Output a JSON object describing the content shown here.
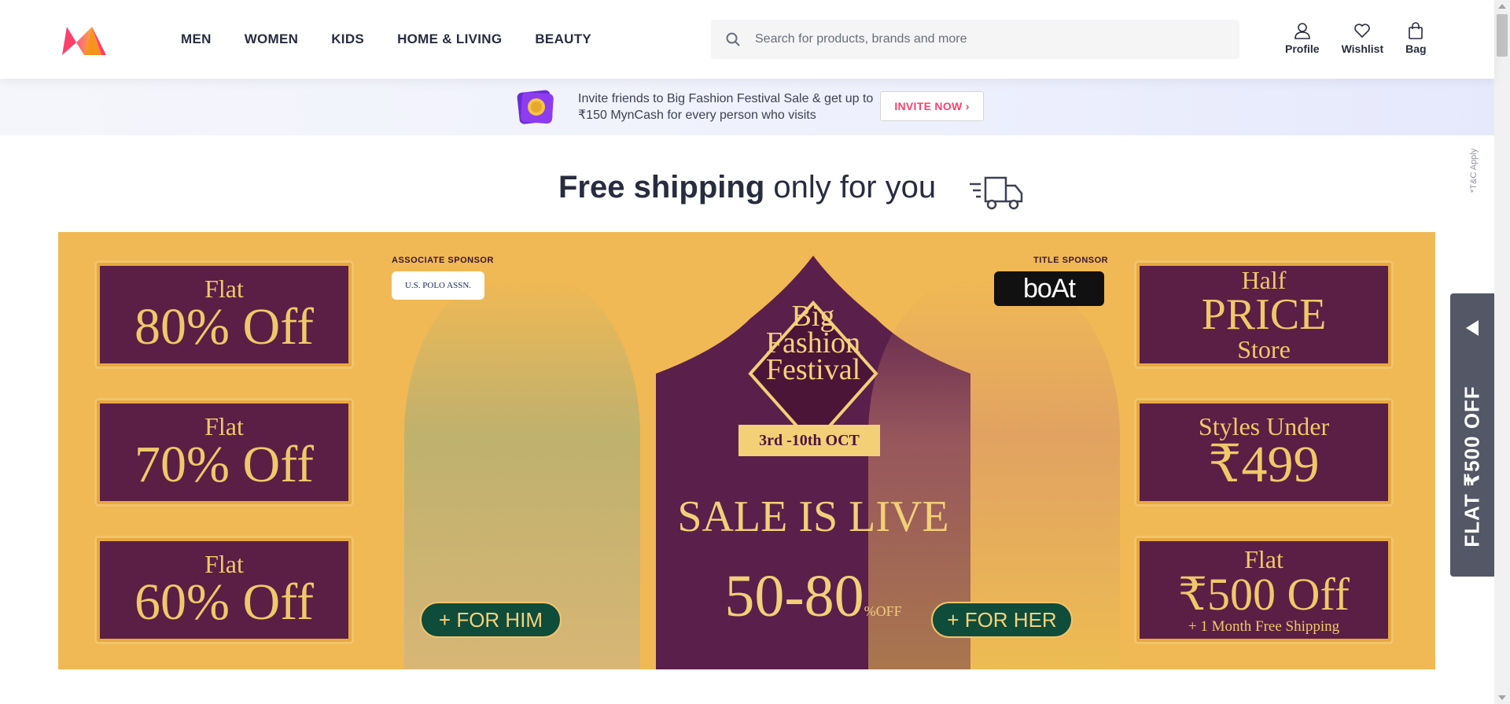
{
  "header": {
    "nav": [
      "MEN",
      "WOMEN",
      "KIDS",
      "HOME & LIVING",
      "BEAUTY"
    ],
    "search_placeholder": "Search for products, brands and more",
    "actions": {
      "profile": "Profile",
      "wishlist": "Wishlist",
      "bag": "Bag"
    }
  },
  "invite": {
    "text": "Invite friends to Big Fashion Festival Sale & get up to ₹150 MynCash for every person who visits",
    "button": "INVITE NOW ›"
  },
  "free_shipping": {
    "bold": "Free shipping",
    "rest": " only for you"
  },
  "banner": {
    "left_tiles": [
      {
        "line1": "Flat",
        "line2": "80% Off"
      },
      {
        "line1": "Flat",
        "line2": "70% Off"
      },
      {
        "line1": "Flat",
        "line2": "60% Off"
      }
    ],
    "right_tiles": {
      "half_price": {
        "line1": "Half",
        "line2": "PRICE",
        "line3": "Store"
      },
      "styles_under": {
        "line1": "Styles Under",
        "line2": "₹499"
      },
      "flat_500": {
        "line1": "Flat",
        "line2": "₹500 Off",
        "line3": "+ 1 Month Free Shipping"
      }
    },
    "associate_sponsor_label": "ASSOCIATE SPONSOR",
    "associate_sponsor": "U.S. POLO ASSN.",
    "title_sponsor_label": "TITLE SPONSOR",
    "title_sponsor": "boAt",
    "festival_line1": "Big",
    "festival_line2": "Fashion",
    "festival_line3": "Festival",
    "dates": "3rd -10th OCT",
    "sale_text": "SALE IS LIVE",
    "discount": "50-80",
    "discount_suffix": "%",
    "discount_off": "OFF",
    "for_him": "+ FOR HIM",
    "for_her": "+ FOR HER"
  },
  "side_tab": {
    "label": "FLAT ₹500 OFF"
  },
  "tnc": "*T&C Apply",
  "colors": {
    "brand_pink": "#ff3f6c",
    "banner_bg": "#f0b955",
    "tile_bg": "#5b1e45",
    "gold": "#f0c86a",
    "side_tab": "#535766"
  }
}
